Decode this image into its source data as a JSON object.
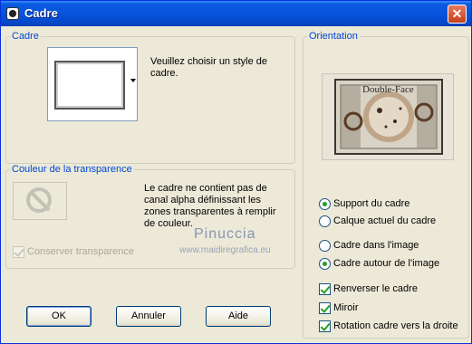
{
  "window": {
    "title": "Cadre",
    "close_glyph": "✕"
  },
  "cadre_group": {
    "legend": "Cadre",
    "description": "Veuillez choisir un style de cadre."
  },
  "transparency_group": {
    "legend": "Couleur de la transparence",
    "info_text": "Le cadre ne contient pas de canal alpha définissant les zones transparentes à remplir de couleur.",
    "checkbox_label": "Conserver transparence",
    "checkbox_checked": true,
    "checkbox_enabled": false
  },
  "orientation_group": {
    "legend": "Orientation",
    "preview_text": "Double-Face",
    "radio_group_1": [
      {
        "label": "Support du cadre",
        "selected": true
      },
      {
        "label": "Calque actuel du cadre",
        "selected": false
      }
    ],
    "radio_group_2": [
      {
        "label": "Cadre dans l'image",
        "selected": false
      },
      {
        "label": "Cadre autour de l'image",
        "selected": true
      }
    ],
    "checkboxes": [
      {
        "label": "Renverser le cadre",
        "checked": true
      },
      {
        "label": "Miroir",
        "checked": true
      },
      {
        "label": "Rotation cadre vers la droite",
        "checked": true
      }
    ]
  },
  "watermark": {
    "line1": "Pinuccia",
    "line2": "www.maidiregrafica.eu"
  },
  "buttons": {
    "ok": "OK",
    "cancel": "Annuler",
    "help": "Aide"
  },
  "colors": {
    "title_blue": "#0753dd",
    "legend_blue": "#0046d5",
    "check_green": "#21a121",
    "dialog_bg": "#ece9d8"
  }
}
